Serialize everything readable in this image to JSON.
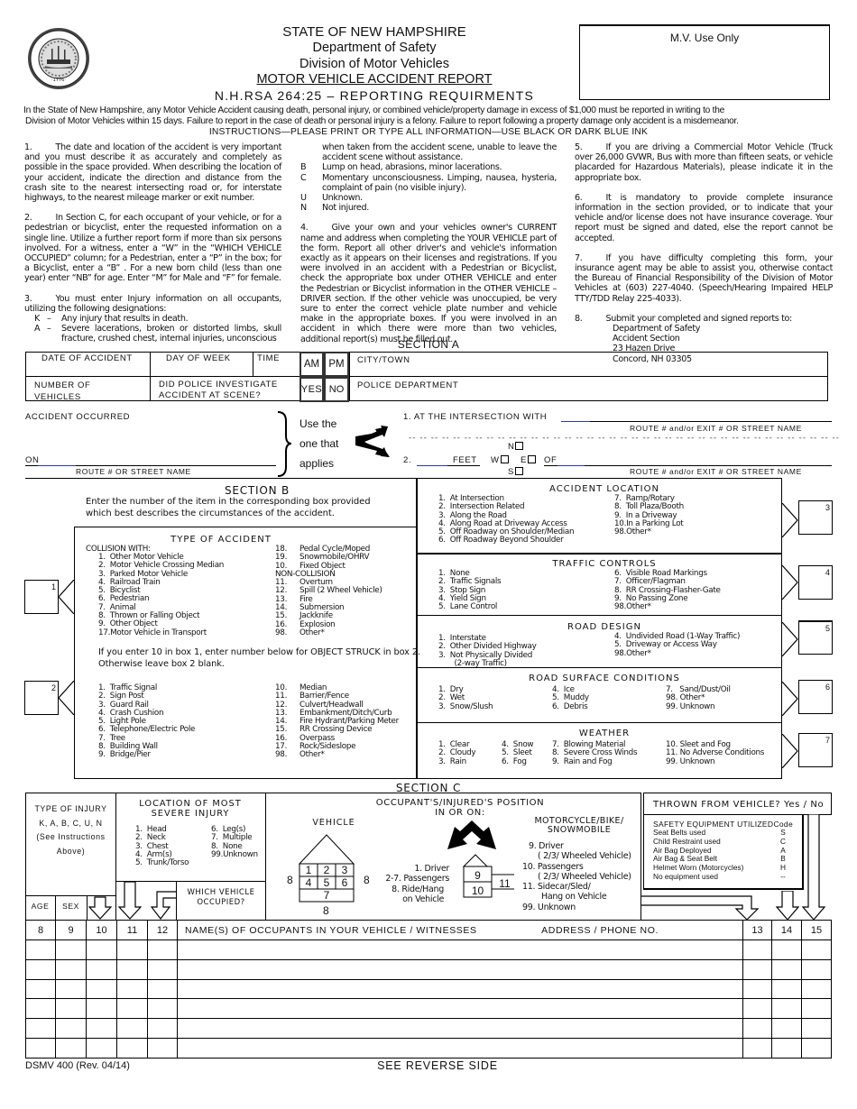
{
  "header": {
    "state": "STATE OF NEW HAMPSHIRE",
    "department": "Department of Safety",
    "division": "Division of Motor Vehicles",
    "form_title": "MOTOR VEHICLE ACCIDENT REPORT",
    "statute": "N.H.RSA 264:25 – REPORTING REQUIRMENTS",
    "seal_icon": "state-seal",
    "mv_use_only": "M.V. Use Only"
  },
  "intro": {
    "line1": "In the State of New Hampshire, any Motor Vehicle Accident causing death, personal injury, or combined vehicle/property damage in excess of $1,000 must be reported in writing to the",
    "line2": "Division of Motor Vehicles within 15 days.  Failure to report in the case of death or personal injury is a felony.  Failure to report following a property damage only accident is a misdemeanor.",
    "instructions": "INSTRUCTIONS—PLEASE PRINT OR TYPE ALL INFORMATION—USE BLACK OR DARK BLUE INK"
  },
  "instructions": {
    "i1": {
      "num": "1.",
      "text": "The date and location of the accident is very important and you must describe it as accurately and completely as possible in the space provided.  When describing the location of your accident, indicate the direction and distance from the crash site to the nearest intersecting road or, for interstate highways, to the nearest mileage marker or exit number."
    },
    "i2": {
      "num": "2.",
      "text": "In Section C, for each occupant of your vehicle, or for a pedestrian or bicyclist, enter the requested information on a single line.  Utilize a further report form if more than six persons involved.  For a witness, enter a “W” in the “WHICH VEHICLE OCCUPIED” column; for a Pedestrian, enter a “P” in the box; for a Bicyclist, enter a “B” . For a new born child (less than one year) enter “NB” for age.  Enter “M” for Male and “F” for female."
    },
    "i3": {
      "num": "3.",
      "text": "You must enter Injury information on all occupants, utilizing the following designations:"
    },
    "designations": [
      {
        "code": "K",
        "text": "Any injury that results in death."
      },
      {
        "code": "A",
        "text": "Severe lacerations, broken or distorted limbs, skull fracture, crushed chest, internal injuries,  unconscious when taken from the accident scene, unable to leave the accident scene without assistance."
      },
      {
        "code": "B",
        "text": "Lump on head, abrasions, minor lacerations."
      },
      {
        "code": "C",
        "text": "Momentary unconsciousness. Limping, nausea, hysteria, complaint of pain (no visible injury)."
      },
      {
        "code": "U",
        "text": "Unknown."
      },
      {
        "code": "N",
        "text": "Not injured."
      }
    ],
    "a_part1": "Severe lacerations, broken or distorted limbs, skull fracture, crushed chest, internal injuries,  unconscious",
    "a_part2": "when taken from the accident scene, unable to leave the accident scene without assistance.",
    "i4": {
      "num": "4.",
      "text": "Give your own and your vehicles owner's CURRENT name and address when completing the YOUR VEHICLE part of the form.  Report all other driver's and vehicle's information exactly as it appears on their licenses and registrations.  If you were involved in an accident with a Pedestrian or Bicyclist, check the appropriate box under OTHER VEHICLE and enter the Pedestrian or Bicyclist information in the OTHER VEHICLE – DRIVER section.  If the other vehicle was unoccupied, be very sure to enter the correct vehicle plate number and vehicle make in the appropriate boxes.  If you were involved in an accident in which there were more than two vehicles, additional report(s) must be filled out."
    },
    "i5": {
      "num": "5.",
      "text": "If you are driving a Commercial Motor Vehicle (Truck over 26,000 GVWR, Bus with more than fifteen seats, or vehicle placarded for Hazardous Materials), please indicate it in the appropriate box."
    },
    "i6": {
      "num": "6.",
      "text": "It is mandatory to provide complete insurance information in the section provided, or to indicate that your vehicle and/or license does not have insurance coverage.  Your report must be signed and dated, else the report cannot be accepted."
    },
    "i7": {
      "num": "7.",
      "text": "If you have difficulty completing this form, your insurance agent may be able to assist you, otherwise contact the Bureau of Financial Responsibility of the Division of Motor Vehicles at (603) 227-4040. (Speech/Hearing Impaired HELP TTY/TDD Relay 225-4033)."
    },
    "i8": {
      "num": "8.",
      "text": "Submit your completed and signed reports to:",
      "address": [
        "Department of Safety",
        "Accident Section",
        "23 Hazen Drive",
        "Concord, NH 03305"
      ]
    }
  },
  "section_a": {
    "title": "SECTION A",
    "date_label": "DATE OF ACCIDENT",
    "day_label": "DAY OF WEEK",
    "time_label": "TIME",
    "am": "AM",
    "pm": "PM",
    "city_label": "CITY/TOWN",
    "num_vehicles_label": "NUMBER OF VEHICLES",
    "police_q_label": "DID POLICE INVESTIGATE ACCIDENT AT SCENE?",
    "yes": "YES",
    "no": "NO",
    "police_dept_label": "POLICE DEPARTMENT",
    "accident_occurred": "ACCIDENT OCCURRED",
    "on_label": "ON",
    "route_street": "ROUTE # OR STREET NAME",
    "use_the": "Use the",
    "one_that": "one that",
    "applies": "applies",
    "intersection": "1.  AT THE INTERSECTION WITH",
    "route_exit_street": "ROUTE # and/or EXIT # OR STREET NAME",
    "opt2": "2.",
    "feet": "FEET",
    "n": "N",
    "w": "W",
    "e": "E",
    "s": "S",
    "of": "OF",
    "dashes": "-- -- -- -- -- -- -- -- -- -- -- -- -- -- -- -- -- -- -- -- -- -- -- -- -- -- -- -- -- -- -- -- -- -- -- -- -- -- --"
  },
  "section_b": {
    "title": "SECTION B",
    "desc1": "Enter the number of the item in the corresponding box provided",
    "desc2": "which best describes the circumstances of the accident.",
    "type_of_accident": {
      "title": "TYPE OF ACCIDENT",
      "collision_with": "COLLISION WITH:",
      "left": [
        "1.  Other Motor Vehicle",
        "2.  Motor Vehicle Crossing Median",
        "3.  Parked Motor Vehicle",
        "4.  Railroad Train",
        "5.  Bicyclist",
        "6.  Pedestrian",
        "7.  Animal",
        "8.  Thrown or Falling Object",
        "9.  Other Object",
        "17.Motor Vehicle in Transport"
      ],
      "right": [
        {
          "n": "18.",
          "t": "Pedal Cycle/Moped"
        },
        {
          "n": "19.",
          "t": "Snowmobile/OHRV"
        },
        {
          "n": "10.",
          "t": "Fixed Object"
        },
        {
          "n": "",
          "t": "NON-COLLISION"
        },
        {
          "n": "11.",
          "t": "Overturn"
        },
        {
          "n": "12.",
          "t": "Spill (2 Wheel Vehicle)"
        },
        {
          "n": "13.",
          "t": "Fire"
        },
        {
          "n": "14.",
          "t": "Submersion"
        },
        {
          "n": "15.",
          "t": "Jackknife"
        },
        {
          "n": "16.",
          "t": "Explosion"
        },
        {
          "n": "98.",
          "t": "Other*"
        }
      ],
      "note1": "If you enter 10 in box 1, enter number below for OBJECT STRUCK in box 2.",
      "note2": "Otherwise leave box 2 blank.",
      "obj_left": [
        "1.  Traffic Signal",
        "2.  Sign Post",
        "3.  Guard Rail",
        "4.  Crash Cushion",
        "5.  Light Pole",
        "6.  Telephone/Electric Pole",
        "7.  Tree",
        "8.  Building Wall",
        "9.  Bridge/Pier"
      ],
      "obj_right": [
        {
          "n": "10.",
          "t": "Median"
        },
        {
          "n": "11.",
          "t": "Barrier/Fence"
        },
        {
          "n": "12.",
          "t": "Culvert/Headwall"
        },
        {
          "n": "13.",
          "t": "Embankment/Ditch/Curb"
        },
        {
          "n": "14.",
          "t": "Fire Hydrant/Parking Meter"
        },
        {
          "n": "15.",
          "t": "RR Crossing Device"
        },
        {
          "n": "16.",
          "t": "Overpass"
        },
        {
          "n": "17.",
          "t": "Rock/Sideslope"
        },
        {
          "n": "98.",
          "t": "Other*"
        }
      ]
    },
    "accident_location": {
      "title": "ACCIDENT LOCATION",
      "left": [
        "1.  At Intersection",
        "2.  Intersection Related",
        "3.  Along the Road",
        "4.  Along Road at Driveway Access",
        "5.  Off Roadway on Shoulder/Median",
        "6.  Off Roadway Beyond Shoulder"
      ],
      "right": [
        "7.  Ramp/Rotary",
        "8.  Toll Plaza/Booth",
        "9.  In a Driveway",
        "10.In a Parking Lot",
        "98.Other*"
      ]
    },
    "traffic_controls": {
      "title": "TRAFFIC CONTROLS",
      "left": [
        "1.  None",
        "2.  Traffic Signals",
        "3.  Stop Sign",
        "4.  Yield Sign",
        "5.  Lane Control"
      ],
      "right": [
        "6.  Visible Road Markings",
        "7.  Officer/Flagman",
        "8.  RR Crossing-Flasher-Gate",
        "9.  No Passing Zone",
        "98.Other*"
      ]
    },
    "road_design": {
      "title": "ROAD DESIGN",
      "left": [
        "1.  Interstate",
        "2.  Other Divided Highway",
        "3.  Not Physically Divided",
        "       (2-way Traffic)"
      ],
      "right": [
        "4.  Undivided Road (1-Way Traffic)",
        "5.  Driveway or Access Way",
        "98.Other*"
      ]
    },
    "road_surface": {
      "title": "ROAD SURFACE CONDITIONS",
      "c1": [
        "1.  Dry",
        "2.  Wet",
        "3.  Snow/Slush"
      ],
      "c2": [
        "4.  Ice",
        "5.  Muddy",
        "6.  Debris"
      ],
      "c3": [
        "7.   Sand/Dust/Oil",
        "98. Other*",
        "99. Unknown"
      ]
    },
    "weather": {
      "title": "WEATHER",
      "c1": [
        "1.  Clear",
        "2.  Cloudy",
        "3.  Rain"
      ],
      "c2": [
        "4.  Snow",
        "5.  Sleet",
        "6.  Fog"
      ],
      "c3": [
        "7.  Blowing Material",
        "8.  Severe Cross Winds",
        "9.  Rain and Fog"
      ],
      "c4": [
        "10. Sleet and Fog",
        "11. No Adverse Conditions",
        "99. Unknown"
      ]
    },
    "boxes": [
      "1",
      "2",
      "3",
      "4",
      "5",
      "6",
      "7"
    ]
  },
  "section_c": {
    "title": "SECTION C",
    "type_of_injury": [
      "TYPE OF INJURY",
      "K, A, B, C, U, N",
      "(See Instructions",
      "Above)"
    ],
    "age": "AGE",
    "sex": "SEX",
    "location_title1": "LOCATION OF MOST",
    "location_title2": "SEVERE INJURY",
    "location_left": [
      "1.  Head",
      "2.  Neck",
      "3.  Chest",
      "4.  Arm(s)",
      "5.  Trunk/Torso"
    ],
    "location_right": [
      "6.  Leg(s)",
      "7.  Multiple",
      "8.  None",
      "99.Unknown"
    ],
    "which_vehicle": "WHICH VEHICLE OCCUPIED?",
    "position_title1": "OCCUPANT'S/INJURED'S POSITION",
    "position_title2": "IN OR ON:",
    "vehicle_label": "VEHICLE",
    "seats": [
      "1",
      "2",
      "3",
      "4",
      "5",
      "6",
      "7"
    ],
    "seat8": "8",
    "vehicle_legend": [
      "1.  Driver",
      "2-7.  Passengers",
      "8.  Ride/Hang",
      "on Vehicle"
    ],
    "moto_seats": [
      "9",
      "10",
      "11"
    ],
    "moto_title1": "MOTORCYCLE/BIKE/",
    "moto_title2": "SNOWMOBILE",
    "moto_legend": [
      "9. Driver",
      "( 2/3/ Wheeled Vehicle)",
      "10. Passengers",
      "( 2/3/ Wheeled Vehicle)",
      "11. Sidecar/Sled/",
      "Hang on Vehicle",
      "99. Unknown"
    ],
    "thrown": "THROWN FROM VEHICLE? Yes / No",
    "safety_title": "SAFETY EQUIPMENT UTILIZED",
    "safety_code": "Code",
    "safety": [
      {
        "item": "Seat Belts used",
        "code": "S"
      },
      {
        "item": "Child Restraint used",
        "code": "C"
      },
      {
        "item": "Air Bag Deployed",
        "code": "A"
      },
      {
        "item": "Air Bag & Seat Belt",
        "code": "B"
      },
      {
        "item": "Helmet Worn (Motorcycles)",
        "code": "H"
      },
      {
        "item": "No equipment used",
        "code": "--"
      }
    ],
    "table": {
      "cols": [
        "8",
        "9",
        "10",
        "11",
        "12"
      ],
      "names_header": "NAME(S) OF OCCUPANTS IN YOUR VEHICLE / WITNESSES",
      "address_header": "ADDRESS / PHONE NO.",
      "right_cols": [
        "13",
        "14",
        "15"
      ],
      "rows": 6
    }
  },
  "footer": {
    "form_id": "DSMV 400 (Rev. 04/14)",
    "see_reverse": "SEE REVERSE SIDE"
  }
}
